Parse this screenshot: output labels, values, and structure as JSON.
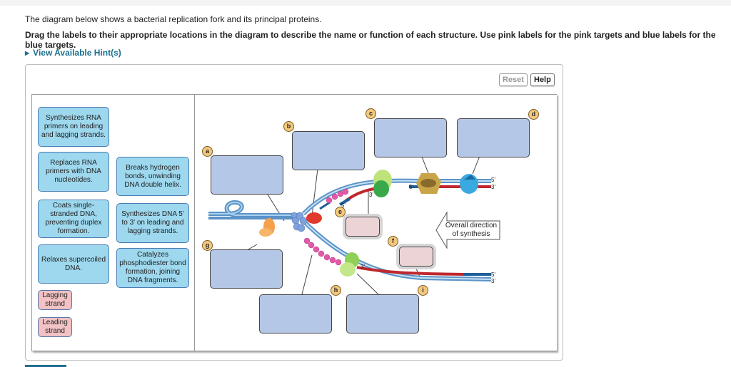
{
  "header": {
    "intro": "The diagram below shows a bacterial replication fork and its principal proteins.",
    "instruction": "Drag the labels to their appropriate locations in the diagram to describe the name or function of each structure. Use pink labels for the pink targets and blue labels for the blue targets.",
    "hint_link": "View Available Hint(s)"
  },
  "toolbar": {
    "reset_label": "Reset",
    "help_label": "Help"
  },
  "label_bank": {
    "blue_labels": [
      "Synthesizes RNA primers on leading and lagging strands.",
      "Replaces RNA primers with DNA nucleotides.",
      "Breaks hydrogen bonds, unwinding DNA double helix.",
      "Coats single-stranded DNA, preventing duplex formation.",
      "Synthesizes DNA 5' to 3' on leading and lagging strands.",
      "Relaxes supercoiled DNA.",
      "Catalyzes phosphodiester bond formation, joining DNA fragments."
    ],
    "pink_labels": [
      "Lagging strand",
      "Leading strand"
    ]
  },
  "diagram": {
    "target_badges": [
      "a",
      "b",
      "c",
      "d",
      "e",
      "f",
      "g",
      "h",
      "i"
    ],
    "blue_targets": [
      "a",
      "b",
      "c",
      "d",
      "g",
      "h",
      "i"
    ],
    "pink_targets": [
      "e",
      "f"
    ],
    "arrow_label": "Overall direction of synthesis",
    "strand_ends": {
      "five_prime": "5'",
      "three_prime": "3'"
    }
  },
  "colors": {
    "blue_label": "#9dd8ee",
    "pink_label": "#f2c2c4",
    "blue_target": "#b5c7e6",
    "pink_target": "#ecd4d6",
    "badge": "#f4c97f",
    "hint_link": "#1a6e8e",
    "strand_blue": "#6fa9d6",
    "strand_red": "#c0272d"
  }
}
